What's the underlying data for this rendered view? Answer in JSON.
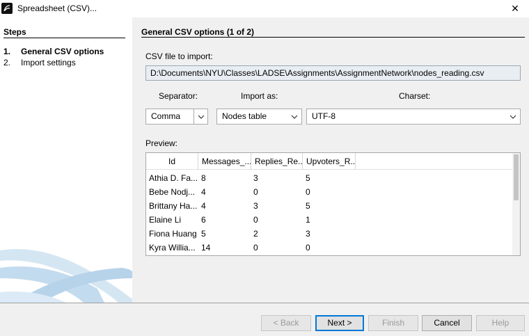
{
  "window": {
    "title": "Spreadsheet (CSV)...",
    "close_glyph": "✕"
  },
  "steps": {
    "header": "Steps",
    "items": [
      {
        "num": "1.",
        "label": "General CSV options",
        "active": true
      },
      {
        "num": "2.",
        "label": "Import settings",
        "active": false
      }
    ]
  },
  "main": {
    "header": "General CSV options (1 of 2)",
    "file_label": "CSV file to import:",
    "file_value": "D:\\Documents\\NYU\\Classes\\LADSE\\Assignments\\AssignmentNetwork\\nodes_reading.csv",
    "separator_label": "Separator:",
    "separator_value": "Comma",
    "import_as_label": "Import as:",
    "import_as_value": "Nodes table",
    "charset_label": "Charset:",
    "charset_value": "UTF-8",
    "preview_label": "Preview:"
  },
  "preview_table": {
    "columns": [
      "Id",
      "Messages_...",
      "Replies_Re...",
      "Upvoters_R..."
    ],
    "rows": [
      [
        "Athia D. Fa...",
        "8",
        "3",
        "5"
      ],
      [
        "Bebe Nodj...",
        "4",
        "0",
        "0"
      ],
      [
        "Brittany Ha...",
        "4",
        "3",
        "5"
      ],
      [
        "Elaine Li",
        "6",
        "0",
        "1"
      ],
      [
        "Fiona Huang",
        "5",
        "2",
        "3"
      ],
      [
        "Kyra Willia...",
        "14",
        "0",
        "0"
      ]
    ]
  },
  "buttons": {
    "back": "< Back",
    "next": "Next >",
    "finish": "Finish",
    "cancel": "Cancel",
    "help": "Help"
  },
  "colors": {
    "accent": "#0078d7",
    "swoosh": "#c9dff0"
  }
}
